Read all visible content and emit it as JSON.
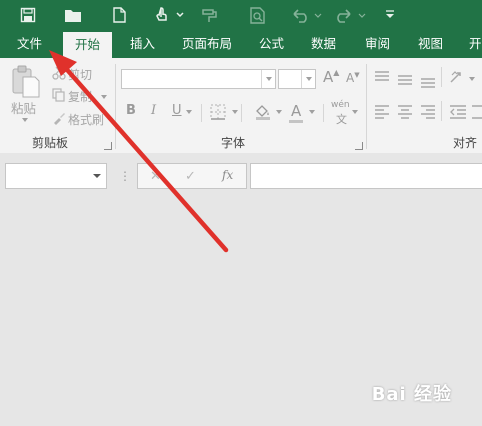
{
  "quick_access": {
    "icons": [
      "save-icon",
      "open-folder-icon",
      "new-file-icon",
      "touch-mode-icon",
      "format-painter-icon",
      "print-preview-icon",
      "undo-icon",
      "redo-icon",
      "customize-icon"
    ]
  },
  "tabs": [
    "文件",
    "开始",
    "插入",
    "页面布局",
    "公式",
    "数据",
    "审阅",
    "视图",
    "开"
  ],
  "active_tab": "开始",
  "clipboard": {
    "paste": "粘贴",
    "cut": "剪切",
    "copy": "复制",
    "format_painter": "格式刷",
    "group": "剪贴板"
  },
  "font": {
    "group": "字体",
    "bold": "B",
    "italic": "I",
    "underline": "U",
    "grow": "A",
    "shrink": "A",
    "font_color": "A",
    "phonetic_top": "wén",
    "phonetic_bottom": "文"
  },
  "alignment": {
    "group": "对齐方"
  },
  "formula_bar": {
    "cancel": "✕",
    "enter": "✓",
    "fx": "fx",
    "dots": "⋮"
  },
  "watermark": "Bai 经验",
  "colors": {
    "accent": "#217346",
    "arrow": "#e0312b"
  }
}
